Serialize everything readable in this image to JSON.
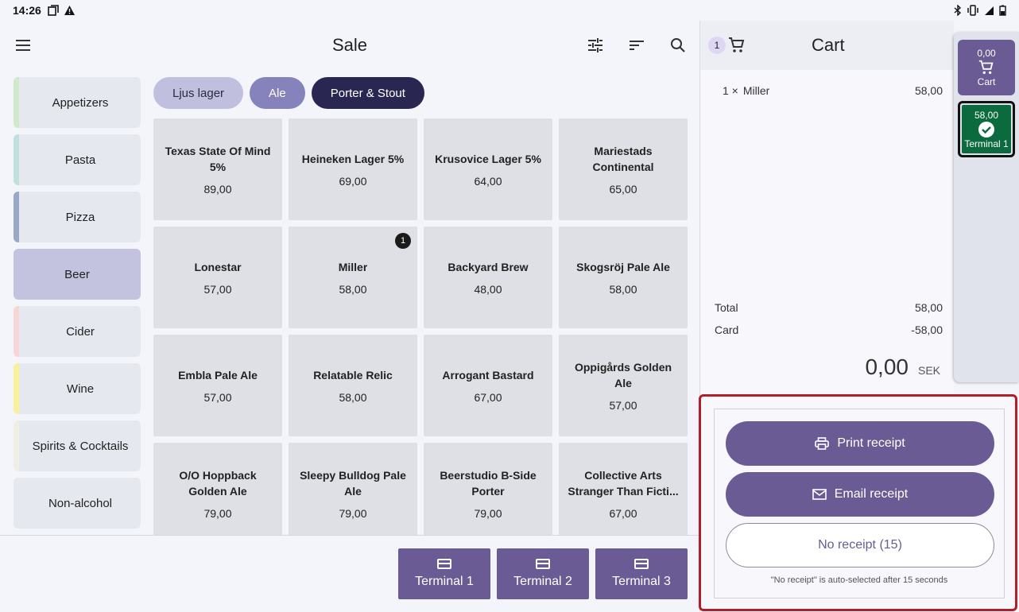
{
  "status_bar": {
    "time": "14:26"
  },
  "header": {
    "title": "Sale"
  },
  "categories": [
    {
      "label": "Appetizers",
      "color": "#cfe9c9"
    },
    {
      "label": "Pasta",
      "color": "#bfe0dc"
    },
    {
      "label": "Pizza",
      "color": "#9aa8c8"
    },
    {
      "label": "Beer",
      "color": "#c3c3e0",
      "active": true
    },
    {
      "label": "Cider",
      "color": "#f6d6d6"
    },
    {
      "label": "Wine",
      "color": "#f8f19a"
    },
    {
      "label": "Spirits & Cocktails",
      "color": "#eef0e4"
    },
    {
      "label": "Non-alcohol",
      "color": "#e6e8f0"
    }
  ],
  "chips": [
    {
      "label": "Ljus lager",
      "bg": "#c0c0de",
      "fg": "#2a2a40"
    },
    {
      "label": "Ale",
      "bg": "#8682bb",
      "fg": "#ffffff"
    },
    {
      "label": "Porter & Stout",
      "bg": "#2a2652",
      "fg": "#ffffff"
    }
  ],
  "products": [
    {
      "name": "Texas State Of Mind 5%",
      "price": "89,00"
    },
    {
      "name": "Heineken Lager 5%",
      "price": "69,00"
    },
    {
      "name": "Krusovice Lager 5%",
      "price": "64,00"
    },
    {
      "name": "Mariestads Continental",
      "price": "65,00"
    },
    {
      "name": "Lonestar",
      "price": "57,00"
    },
    {
      "name": "Miller",
      "price": "58,00",
      "badge": "1"
    },
    {
      "name": "Backyard Brew",
      "price": "48,00"
    },
    {
      "name": "Skogsröj Pale Ale",
      "price": "58,00"
    },
    {
      "name": "Embla Pale Ale",
      "price": "57,00"
    },
    {
      "name": "Relatable Relic",
      "price": "58,00"
    },
    {
      "name": "Arrogant Bastard",
      "price": "67,00"
    },
    {
      "name": "Oppigårds Golden Ale",
      "price": "57,00"
    },
    {
      "name": "O/O Hoppback Golden Ale",
      "price": "79,00"
    },
    {
      "name": "Sleepy Bulldog Pale Ale",
      "price": "79,00"
    },
    {
      "name": "Beerstudio B-Side Porter",
      "price": "79,00"
    },
    {
      "name": "Collective Arts Stranger Than Ficti...",
      "price": "67,00"
    }
  ],
  "terminals": [
    "Terminal 1",
    "Terminal 2",
    "Terminal 3"
  ],
  "cart": {
    "title": "Cart",
    "count": "1",
    "items": [
      {
        "qty": "1 ×",
        "name": "Miller",
        "amount": "58,00"
      }
    ],
    "total_label": "Total",
    "total_value": "58,00",
    "card_label": "Card",
    "card_value": "-58,00",
    "remaining": "0,00",
    "currency": "SEK"
  },
  "rail": {
    "cart_amount": "0,00",
    "cart_label": "Cart",
    "terminal_amount": "58,00",
    "terminal_label": "Terminal 1"
  },
  "receipt": {
    "print_label": "Print receipt",
    "email_label": "Email receipt",
    "none_label": "No receipt (15)",
    "note": "\"No receipt\" is auto-selected after 15 seconds"
  }
}
